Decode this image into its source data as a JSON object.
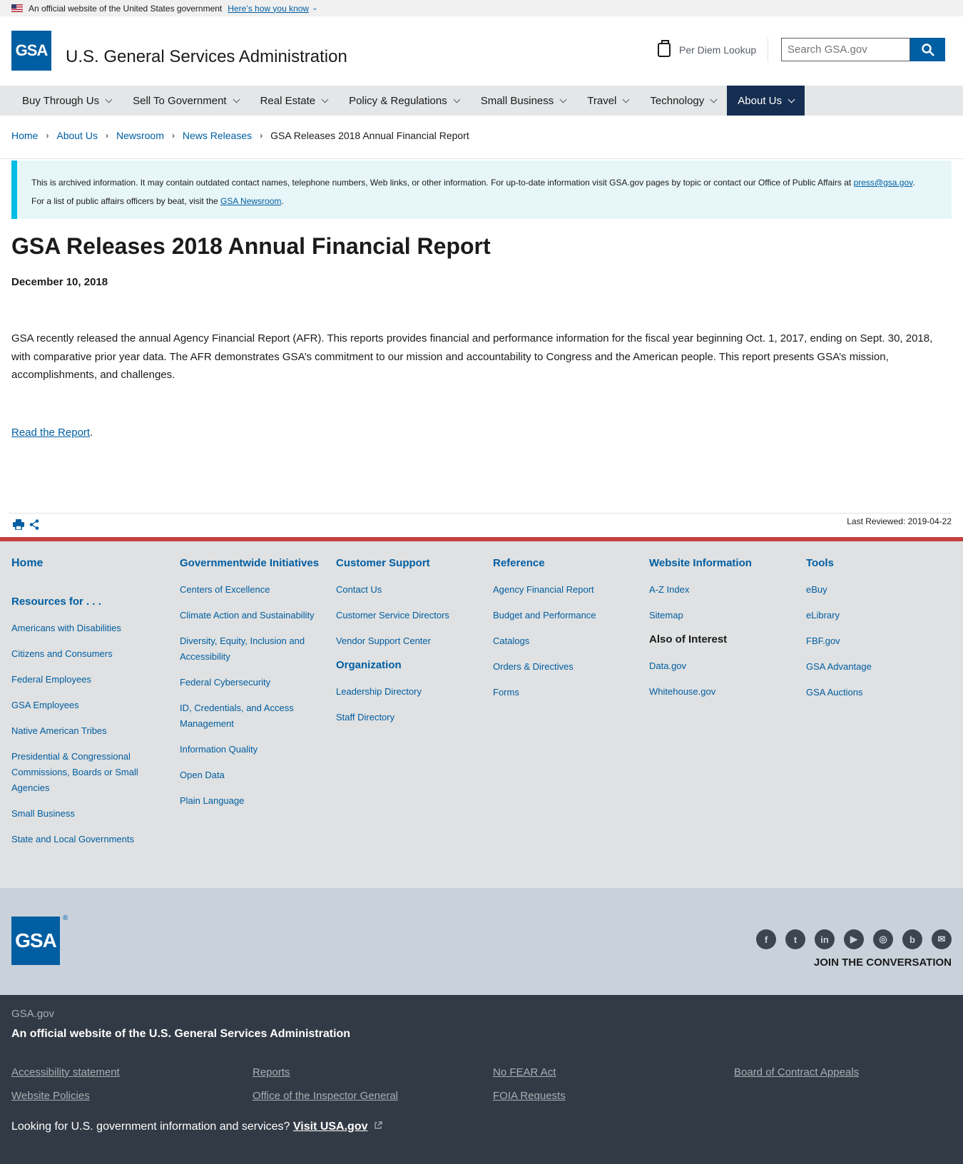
{
  "gov_banner": {
    "text": "An official website of the United States government",
    "link": "Here’s how you know"
  },
  "header": {
    "logo_text": "GSA",
    "site_title": "U.S. General Services Administration",
    "per_diem": "Per Diem Lookup",
    "search_placeholder": "Search GSA.gov"
  },
  "nav": {
    "items": [
      {
        "label": "Buy Through Us"
      },
      {
        "label": "Sell To Government"
      },
      {
        "label": "Real Estate"
      },
      {
        "label": "Policy & Regulations"
      },
      {
        "label": "Small Business"
      },
      {
        "label": "Travel"
      },
      {
        "label": "Technology"
      },
      {
        "label": "About Us",
        "active": true
      }
    ]
  },
  "breadcrumb": [
    "Home",
    "About Us",
    "Newsroom",
    "News Releases",
    "GSA Releases 2018 Annual Financial Report"
  ],
  "alert": {
    "text1": "This is archived information. It may contain outdated contact names, telephone numbers, Web links, or other information. For up-to-date information visit GSA.gov pages by topic or contact our Office of Public Affairs at ",
    "email": "press@gsa.gov",
    "text2": ".",
    "text3": "For a list of public affairs officers by beat, visit the ",
    "newsroom": "GSA Newsroom",
    "text4": "."
  },
  "article": {
    "title": "GSA Releases 2018 Annual Financial Report",
    "date": "December 10, 2018",
    "body": "GSA recently released the annual Agency Financial Report (AFR). This reports provides financial and performance information for the fiscal year beginning Oct. 1, 2017, ending on Sept. 30, 2018, with comparative prior year data. The AFR demonstrates GSA’s commitment to our mission and accountability to Congress and the American people. This report presents GSA’s mission, accomplishments, and challenges.",
    "read_link": "Read the Report",
    "read_suffix": ".",
    "last_reviewed": "Last Reviewed: 2019-04-22"
  },
  "footer_nav": {
    "home": "Home",
    "resources_title": "Resources for . . .",
    "resources": [
      "Americans with Disabilities",
      "Citizens and Consumers",
      "Federal Employees",
      "GSA Employees",
      "Native American Tribes",
      "Presidential & Congressional Commissions, Boards or Small Agencies",
      "Small Business",
      "State and Local Governments"
    ],
    "gov_title": "Governmentwide Initiatives",
    "gov": [
      "Centers of Excellence",
      "Climate Action and Sustainability",
      "Diversity, Equity, Inclusion and Accessibility",
      "Federal Cybersecurity",
      "ID, Credentials, and Access Management",
      "Information Quality",
      "Open Data",
      "Plain Language"
    ],
    "support_title": "Customer Support",
    "support": [
      "Contact Us",
      "Customer Service Directors",
      "Vendor Support Center"
    ],
    "org_title": "Organization",
    "org": [
      "Leadership Directory",
      "Staff Directory"
    ],
    "reference_title": "Reference",
    "reference": [
      "Agency Financial Report",
      "Budget and Performance",
      "Catalogs",
      "Orders & Directives",
      "Forms"
    ],
    "website_title": "Website Information",
    "website": [
      "A-Z Index",
      "Sitemap"
    ],
    "interest_title": "Also of Interest",
    "interest": [
      "Data.gov",
      "Whitehouse.gov"
    ],
    "tools_title": "Tools",
    "tools": [
      "eBuy",
      "eLibrary",
      "FBF.gov",
      "GSA Advantage",
      "GSA Auctions"
    ]
  },
  "social": {
    "logo_text": "GSA",
    "logo_mark": "®",
    "icons": [
      "facebook-icon",
      "twitter-icon",
      "linkedin-icon",
      "youtube-icon",
      "instagram-icon",
      "blog-icon",
      "email-icon"
    ],
    "join": "JOIN THE CONVERSATION"
  },
  "identifier": {
    "domain": "GSA.gov",
    "official": "An official website of the U.S. General Services Administration",
    "links": [
      "Accessibility statement",
      "Reports",
      "No FEAR Act",
      "Board of Contract Appeals",
      "Website Policies",
      "Office of the Inspector General",
      "FOIA Requests"
    ],
    "usa_text": "Looking for U.S. government information and services? ",
    "usa_link": "Visit USA.gov"
  }
}
